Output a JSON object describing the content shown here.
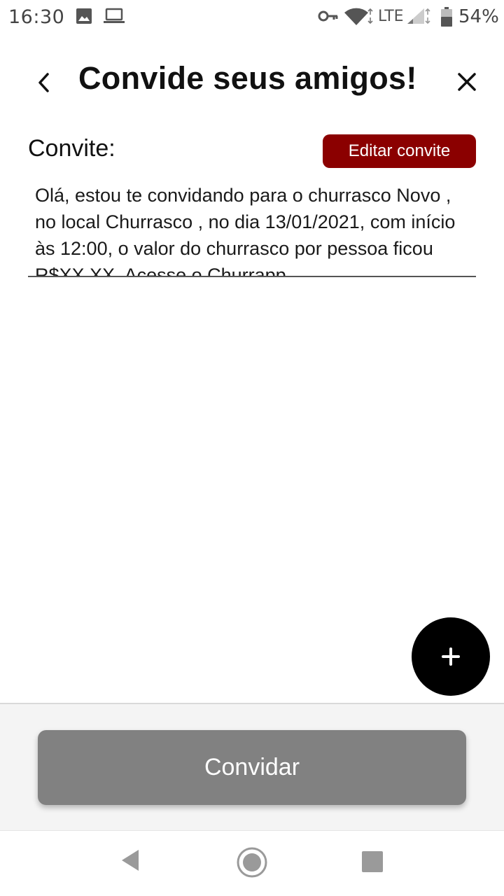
{
  "status_bar": {
    "time": "16:30",
    "network": "LTE",
    "battery": "54%",
    "icons": [
      "image-icon",
      "laptop-icon",
      "vpn-key-icon",
      "wifi-icon",
      "signal-icon",
      "battery-icon"
    ]
  },
  "header": {
    "title": "Convide seus amigos!",
    "back_icon": "chevron-left-icon",
    "close_icon": "close-icon"
  },
  "invite": {
    "label": "Convite:",
    "edit_button": "Editar convite",
    "text": "Olá, estou te convidando para o churrasco Novo , no local Churrasco , no dia 13/01/2021, com início às 12:00, o valor do churrasco por pessoa ficou R$XX,XX. Acesse o Churrapp"
  },
  "fab": {
    "icon": "plus-icon"
  },
  "footer": {
    "invite_button": "Convidar"
  },
  "nav_bar": {
    "icons": [
      "nav-back-icon",
      "nav-home-icon",
      "nav-recents-icon"
    ]
  },
  "colors": {
    "accent": "#8b0000",
    "fab": "#000000",
    "primary_button_disabled": "#818181",
    "footer_background": "#f4f4f4"
  }
}
